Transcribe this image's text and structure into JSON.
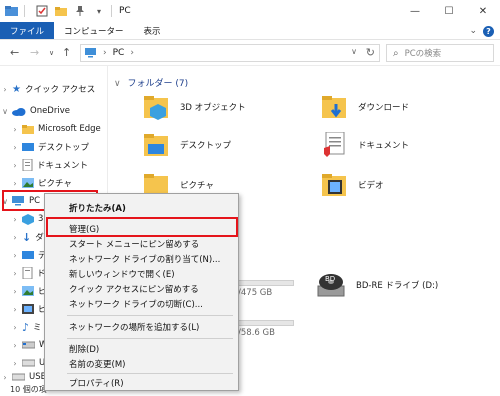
{
  "titlebar": {
    "title": "PC",
    "icons": [
      "folder-icon",
      "checkbox-icon",
      "folder-icon",
      "pin-icon",
      "dropdown-icon"
    ],
    "minimize": "—",
    "maximize": "☐",
    "close": "✕"
  },
  "ribbon": {
    "tabs": [
      "ファイル",
      "コンピューター",
      "表示"
    ],
    "expand": "⌄",
    "help": "?"
  },
  "address": {
    "path": "PC",
    "search_placeholder": "PCの検索"
  },
  "navpane": {
    "items": [
      {
        "label": "クイック アクセス",
        "icon": "star-icon"
      },
      {
        "label": "OneDrive",
        "icon": "cloud-icon"
      },
      {
        "label": "Microsoft Edge",
        "icon": "folder-icon"
      },
      {
        "label": "デスクトップ",
        "icon": "desktop-icon"
      },
      {
        "label": "ドキュメント",
        "icon": "document-icon"
      },
      {
        "label": "ピクチャ",
        "icon": "picture-icon"
      },
      {
        "label": "PC",
        "icon": "pc-icon"
      },
      {
        "label": "3",
        "icon": "cube-icon"
      },
      {
        "label": "ダ",
        "icon": "download-icon"
      },
      {
        "label": "デ",
        "icon": "desktop-icon"
      },
      {
        "label": "ド",
        "icon": "document-icon"
      },
      {
        "label": "ピ",
        "icon": "picture-icon"
      },
      {
        "label": "ビ",
        "icon": "video-icon"
      },
      {
        "label": "ミ",
        "icon": "music-icon"
      },
      {
        "label": "W",
        "icon": "drive-icon"
      },
      {
        "label": "U",
        "icon": "drive-icon"
      },
      {
        "label": "USB",
        "icon": "usb-icon"
      }
    ]
  },
  "content": {
    "group_title": "フォルダー (7)",
    "folders": [
      {
        "name": "3D オブジェクト",
        "icon": "cube-folder-icon"
      },
      {
        "name": "ダウンロード",
        "icon": "download-folder-icon"
      },
      {
        "name": "デスクトップ",
        "icon": "desktop-folder-icon"
      },
      {
        "name": "ドキュメント",
        "icon": "document-folder-icon"
      },
      {
        "name": "ピクチャ",
        "icon": "picture-folder-icon"
      },
      {
        "name": "ビデオ",
        "icon": "video-folder-icon"
      }
    ],
    "drive1_size": "475 GB",
    "drive2_size": "58.6 GB",
    "bd_drive": "BD-RE ドライブ (D:)",
    "bd_badge": "BD"
  },
  "context_menu": {
    "items": [
      "折りたたみ(A)",
      "管理(G)",
      "スタート メニューにピン留めする",
      "ネットワーク ドライブの割り当て(N)...",
      "新しいウィンドウで開く(E)",
      "クイック アクセスにピン留めする",
      "ネットワーク ドライブの切断(C)...",
      "ネットワークの場所を追加する(L)",
      "削除(D)",
      "名前の変更(M)",
      "プロパティ(R)"
    ]
  },
  "statusbar": {
    "text": "10 個の項"
  },
  "colors": {
    "accent": "#1a5fb4",
    "highlight": "#e5141b",
    "folder": "#f5c44d"
  }
}
